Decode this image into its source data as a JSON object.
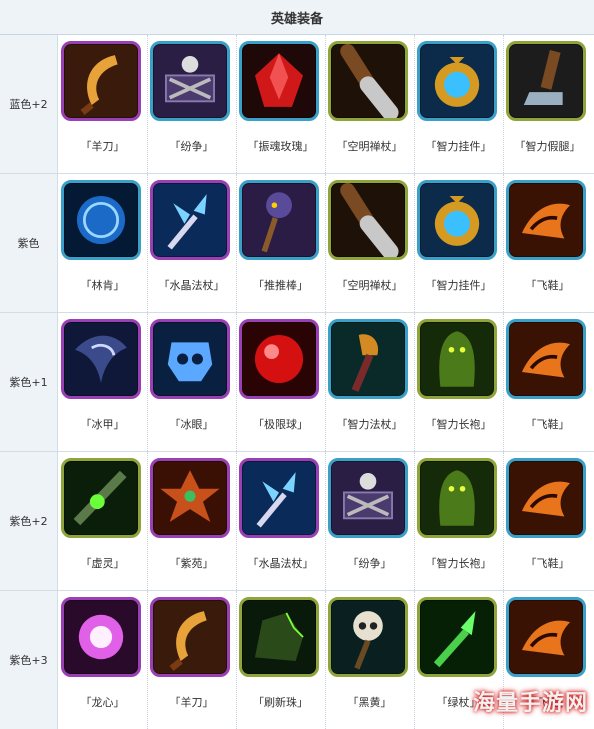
{
  "header": {
    "title": "英雄装备"
  },
  "rows": [
    {
      "label": "蓝色+2",
      "items": [
        {
          "name": "「羊刀」",
          "icon": "golden-scythe-icon",
          "frame": "#9a3fb4"
        },
        {
          "name": "「纷争」",
          "icon": "skull-crossbones-icon",
          "frame": "#3aa0c8"
        },
        {
          "name": "「振魂玫瑰」",
          "icon": "red-gem-icon",
          "frame": "#3aa0c8"
        },
        {
          "name": "「空明禅杖」",
          "icon": "staff-handle-icon",
          "frame": "#8fa43a"
        },
        {
          "name": "「智力挂件」",
          "icon": "amulet-icon",
          "frame": "#3aa0c8"
        },
        {
          "name": "「智力假腿」",
          "icon": "peg-leg-icon",
          "frame": "#8fa43a"
        }
      ]
    },
    {
      "label": "紫色",
      "items": [
        {
          "name": "「林肯」",
          "icon": "blue-orb-icon",
          "frame": "#3aa0c8"
        },
        {
          "name": "「水晶法杖」",
          "icon": "crystal-staff-icon",
          "frame": "#9a3fb4"
        },
        {
          "name": "「推推棒」",
          "icon": "hooded-staff-icon",
          "frame": "#3aa0c8"
        },
        {
          "name": "「空明禅杖」",
          "icon": "staff-handle-icon",
          "frame": "#8fa43a"
        },
        {
          "name": "「智力挂件」",
          "icon": "amulet-icon",
          "frame": "#3aa0c8"
        },
        {
          "name": "「飞鞋」",
          "icon": "winged-boot-icon",
          "frame": "#3aa0c8"
        }
      ]
    },
    {
      "label": "紫色+1",
      "items": [
        {
          "name": "「冰甲」",
          "icon": "ice-armor-icon",
          "frame": "#9a3fb4"
        },
        {
          "name": "「冰眼」",
          "icon": "ice-skull-icon",
          "frame": "#9a3fb4"
        },
        {
          "name": "「极限球」",
          "icon": "red-orb-icon",
          "frame": "#9a3fb4"
        },
        {
          "name": "「智力法杖」",
          "icon": "gauntlet-staff-icon",
          "frame": "#3aa0c8"
        },
        {
          "name": "「智力长袍」",
          "icon": "green-robe-icon",
          "frame": "#8fa43a"
        },
        {
          "name": "「飞鞋」",
          "icon": "winged-boot-icon",
          "frame": "#3aa0c8"
        }
      ]
    },
    {
      "label": "紫色+2",
      "items": [
        {
          "name": "「虚灵」",
          "icon": "ethereal-blade-icon",
          "frame": "#8fa43a"
        },
        {
          "name": "「紫苑」",
          "icon": "orchid-icon",
          "frame": "#9a3fb4"
        },
        {
          "name": "「水晶法杖」",
          "icon": "crystal-staff-icon",
          "frame": "#9a3fb4"
        },
        {
          "name": "「纷争」",
          "icon": "skull-crossbones-icon",
          "frame": "#3aa0c8"
        },
        {
          "name": "「智力长袍」",
          "icon": "green-robe-icon",
          "frame": "#8fa43a"
        },
        {
          "name": "「飞鞋」",
          "icon": "winged-boot-icon",
          "frame": "#3aa0c8"
        }
      ]
    },
    {
      "label": "紫色+3",
      "items": [
        {
          "name": "「龙心」",
          "icon": "pink-glow-icon",
          "frame": "#9a3fb4"
        },
        {
          "name": "「羊刀」",
          "icon": "golden-scythe-icon",
          "frame": "#9a3fb4"
        },
        {
          "name": "「刷新珠」",
          "icon": "green-rock-icon",
          "frame": "#8fa43a"
        },
        {
          "name": "「黑黄」",
          "icon": "skull-staff-icon",
          "frame": "#8fa43a"
        },
        {
          "name": "「绿杖」",
          "icon": "green-crystal-icon",
          "frame": "#8fa43a"
        },
        {
          "name": "「飞鞋」",
          "icon": "winged-boot-icon",
          "frame": "#3aa0c8"
        }
      ]
    }
  ],
  "watermark": "海量手游网"
}
